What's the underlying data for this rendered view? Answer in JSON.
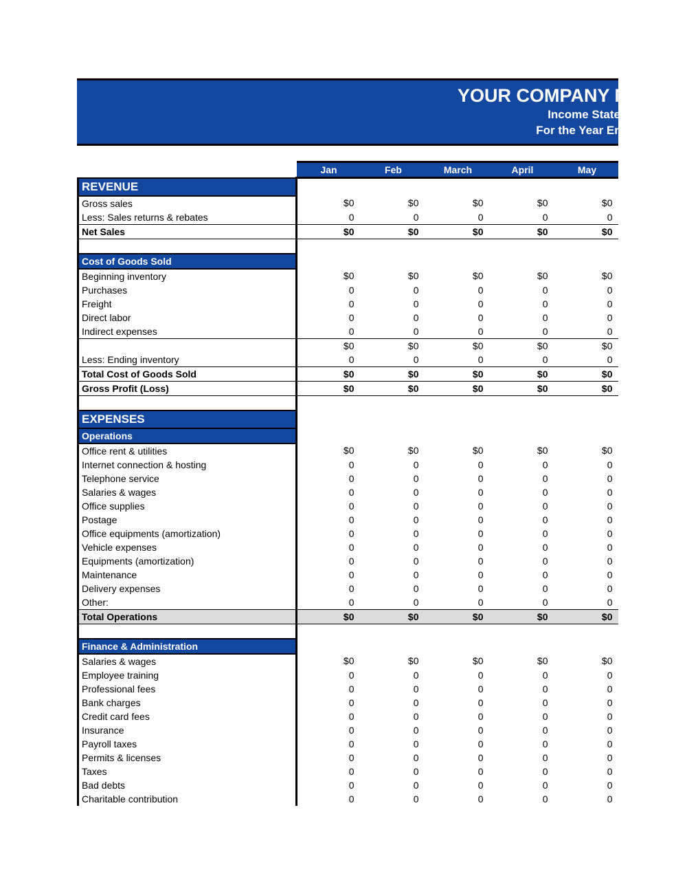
{
  "document": {
    "company_title": "YOUR COMPANY NAME",
    "subtitle_1": "Income Statement -",
    "subtitle_2": "For the Year Ending on"
  },
  "colors": {
    "header_blue": "#14489E",
    "total_shade": "#DCDCDC",
    "text": "#000000",
    "header_text": "#FFFFFF"
  },
  "columns": [
    "Jan",
    "Feb",
    "March",
    "April",
    "May"
  ],
  "sections": {
    "revenue": {
      "heading": "REVENUE",
      "rows": [
        {
          "label": "Gross sales",
          "values": [
            "$0",
            "$0",
            "$0",
            "$0",
            "$0"
          ]
        },
        {
          "label": "Less: Sales returns & rebates",
          "values": [
            "0",
            "0",
            "0",
            "0",
            "0"
          ]
        },
        {
          "label": "Net Sales",
          "values": [
            "$0",
            "$0",
            "$0",
            "$0",
            "$0"
          ]
        }
      ]
    },
    "cogs": {
      "heading": "Cost of Goods Sold",
      "rows": [
        {
          "label": "Beginning inventory",
          "values": [
            "$0",
            "$0",
            "$0",
            "$0",
            "$0"
          ]
        },
        {
          "label": "Purchases",
          "values": [
            "0",
            "0",
            "0",
            "0",
            "0"
          ]
        },
        {
          "label": "Freight",
          "values": [
            "0",
            "0",
            "0",
            "0",
            "0"
          ]
        },
        {
          "label": "Direct labor",
          "values": [
            "0",
            "0",
            "0",
            "0",
            "0"
          ]
        },
        {
          "label": "Indirect expenses",
          "values": [
            "0",
            "0",
            "0",
            "0",
            "0"
          ]
        },
        {
          "label": "",
          "values": [
            "$0",
            "$0",
            "$0",
            "$0",
            "$0"
          ]
        },
        {
          "label": "Less: Ending inventory",
          "values": [
            "0",
            "0",
            "0",
            "0",
            "0"
          ]
        },
        {
          "label": "Total Cost of Goods Sold",
          "values": [
            "$0",
            "$0",
            "$0",
            "$0",
            "$0"
          ]
        },
        {
          "label": "Gross Profit (Loss)",
          "values": [
            "$0",
            "$0",
            "$0",
            "$0",
            "$0"
          ]
        }
      ]
    },
    "expenses": {
      "heading": "EXPENSES"
    },
    "operations": {
      "heading": "Operations",
      "rows": [
        {
          "label": "Office rent & utilities",
          "values": [
            "$0",
            "$0",
            "$0",
            "$0",
            "$0"
          ]
        },
        {
          "label": "Internet connection & hosting",
          "values": [
            "0",
            "0",
            "0",
            "0",
            "0"
          ]
        },
        {
          "label": "Telephone service",
          "values": [
            "0",
            "0",
            "0",
            "0",
            "0"
          ]
        },
        {
          "label": "Salaries & wages",
          "values": [
            "0",
            "0",
            "0",
            "0",
            "0"
          ]
        },
        {
          "label": "Office supplies",
          "values": [
            "0",
            "0",
            "0",
            "0",
            "0"
          ]
        },
        {
          "label": "Postage",
          "values": [
            "0",
            "0",
            "0",
            "0",
            "0"
          ]
        },
        {
          "label": "Office equipments (amortization)",
          "values": [
            "0",
            "0",
            "0",
            "0",
            "0"
          ]
        },
        {
          "label": "Vehicle expenses",
          "values": [
            "0",
            "0",
            "0",
            "0",
            "0"
          ]
        },
        {
          "label": "Equipments (amortization)",
          "values": [
            "0",
            "0",
            "0",
            "0",
            "0"
          ]
        },
        {
          "label": "Maintenance",
          "values": [
            "0",
            "0",
            "0",
            "0",
            "0"
          ]
        },
        {
          "label": "Delivery expenses",
          "values": [
            "0",
            "0",
            "0",
            "0",
            "0"
          ]
        },
        {
          "label": "Other:",
          "values": [
            "0",
            "0",
            "0",
            "0",
            "0"
          ]
        }
      ],
      "total": {
        "label": "Total Operations",
        "values": [
          "$0",
          "$0",
          "$0",
          "$0",
          "$0"
        ]
      }
    },
    "finance": {
      "heading": "Finance & Administration",
      "rows": [
        {
          "label": "Salaries & wages",
          "values": [
            "$0",
            "$0",
            "$0",
            "$0",
            "$0"
          ]
        },
        {
          "label": "Employee training",
          "values": [
            "0",
            "0",
            "0",
            "0",
            "0"
          ]
        },
        {
          "label": "Professional fees",
          "values": [
            "0",
            "0",
            "0",
            "0",
            "0"
          ]
        },
        {
          "label": "Bank charges",
          "values": [
            "0",
            "0",
            "0",
            "0",
            "0"
          ]
        },
        {
          "label": "Credit card fees",
          "values": [
            "0",
            "0",
            "0",
            "0",
            "0"
          ]
        },
        {
          "label": "Insurance",
          "values": [
            "0",
            "0",
            "0",
            "0",
            "0"
          ]
        },
        {
          "label": "Payroll taxes",
          "values": [
            "0",
            "0",
            "0",
            "0",
            "0"
          ]
        },
        {
          "label": "Permits & licenses",
          "values": [
            "0",
            "0",
            "0",
            "0",
            "0"
          ]
        },
        {
          "label": "Taxes",
          "values": [
            "0",
            "0",
            "0",
            "0",
            "0"
          ]
        },
        {
          "label": "Bad debts",
          "values": [
            "0",
            "0",
            "0",
            "0",
            "0"
          ]
        },
        {
          "label": "Charitable contribution",
          "values": [
            "0",
            "0",
            "0",
            "0",
            "0"
          ]
        }
      ]
    }
  }
}
